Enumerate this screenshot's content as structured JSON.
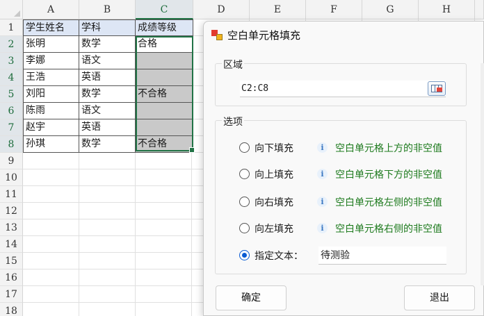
{
  "sheet": {
    "columns": [
      "A",
      "B",
      "C",
      "D",
      "E",
      "F",
      "G",
      "H"
    ],
    "rows": [
      "1",
      "2",
      "3",
      "4",
      "5",
      "6",
      "7",
      "8",
      "9",
      "10",
      "11",
      "12",
      "13",
      "14",
      "15",
      "16",
      "17",
      "18"
    ],
    "data": [
      [
        "学生姓名",
        "学科",
        "成绩等级"
      ],
      [
        "张明",
        "数学",
        "合格"
      ],
      [
        "李娜",
        "语文",
        ""
      ],
      [
        "王浩",
        "英语",
        ""
      ],
      [
        "刘阳",
        "数学",
        "不合格"
      ],
      [
        "陈雨",
        "语文",
        ""
      ],
      [
        "赵宇",
        "英语",
        ""
      ],
      [
        "孙琪",
        "数学",
        "不合格"
      ]
    ],
    "colors": {
      "header_fill": "#dde6f5",
      "blank_fill": "#c9c9c9",
      "selection": "#217346"
    }
  },
  "dialog": {
    "title": "空白单元格填充",
    "range_group_label": "区域",
    "range_value": "C2:C8",
    "options_group_label": "选项",
    "options": [
      {
        "label": "向下填充",
        "hint": "空白单元格上方的非空值",
        "selected": false
      },
      {
        "label": "向上填充",
        "hint": "空白单元格下方的非空值",
        "selected": false
      },
      {
        "label": "向右填充",
        "hint": "空白单元格左侧的非空值",
        "selected": false
      },
      {
        "label": "向左填充",
        "hint": "空白单元格右侧的非空值",
        "selected": false
      }
    ],
    "custom_text_label": "指定文本：",
    "custom_text_selected": true,
    "custom_text_value": "待测验",
    "info_glyph": "i",
    "ok_label": "确定",
    "cancel_label": "退出",
    "hint_color": "#1d7a1d",
    "radio_color": "#0a5bd3"
  }
}
